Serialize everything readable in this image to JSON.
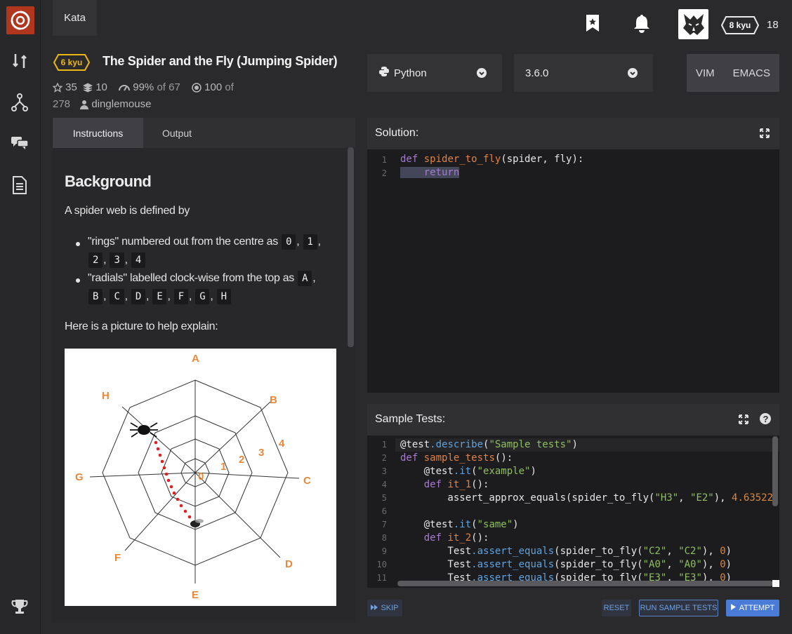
{
  "nav": {
    "kata_tab": "Kata"
  },
  "user": {
    "rank": "8 kyu",
    "honor": "18"
  },
  "kata": {
    "kyu": "6 kyu",
    "title": "The Spider and the Fly (Jumping Spider)",
    "stars": "35",
    "collections": "10",
    "satisfaction_pct": "99%",
    "satisfaction_of": "of 67",
    "completed": "100",
    "completed_of": "of",
    "completed_total": "278",
    "author": "dinglemouse"
  },
  "selectors": {
    "language": "Python",
    "version": "3.6.0",
    "vim": "VIM",
    "emacs": "EMACS"
  },
  "tabs": {
    "instructions": "Instructions",
    "output": "Output"
  },
  "instructions": {
    "heading": "Background",
    "intro": "A spider web is defined by",
    "bullet1_text": "\"rings\" numbered out from the centre as",
    "bullet1_codes": [
      "0",
      "1",
      "2",
      "3",
      "4"
    ],
    "bullet2_text": "\"radials\" labelled clock-wise from the top as",
    "bullet2_codes": [
      "A",
      "B",
      "C",
      "D",
      "E",
      "F",
      "G",
      "H"
    ],
    "picture_caption": "Here is a picture to help explain:",
    "figure_labels": {
      "radials": [
        "A",
        "B",
        "C",
        "D",
        "E",
        "F",
        "G",
        "H"
      ],
      "rings": [
        "0",
        "1",
        "2",
        "3",
        "4"
      ]
    }
  },
  "solution": {
    "title": "Solution:",
    "lines": [
      "1",
      "2"
    ]
  },
  "tests": {
    "title": "Sample Tests:",
    "line_numbers": [
      "1",
      "2",
      "3",
      "4",
      "5",
      "6",
      "7",
      "8",
      "9",
      "10",
      "11"
    ]
  },
  "buttons": {
    "skip": "SKIP",
    "reset": "RESET",
    "run": "RUN SAMPLE TESTS",
    "attempt": "ATTEMPT"
  },
  "colors": {
    "accent": "#b1361e",
    "kyu": "#ecb613",
    "attempt": "#4a7bd6",
    "figure_orange": "#e8883a"
  }
}
